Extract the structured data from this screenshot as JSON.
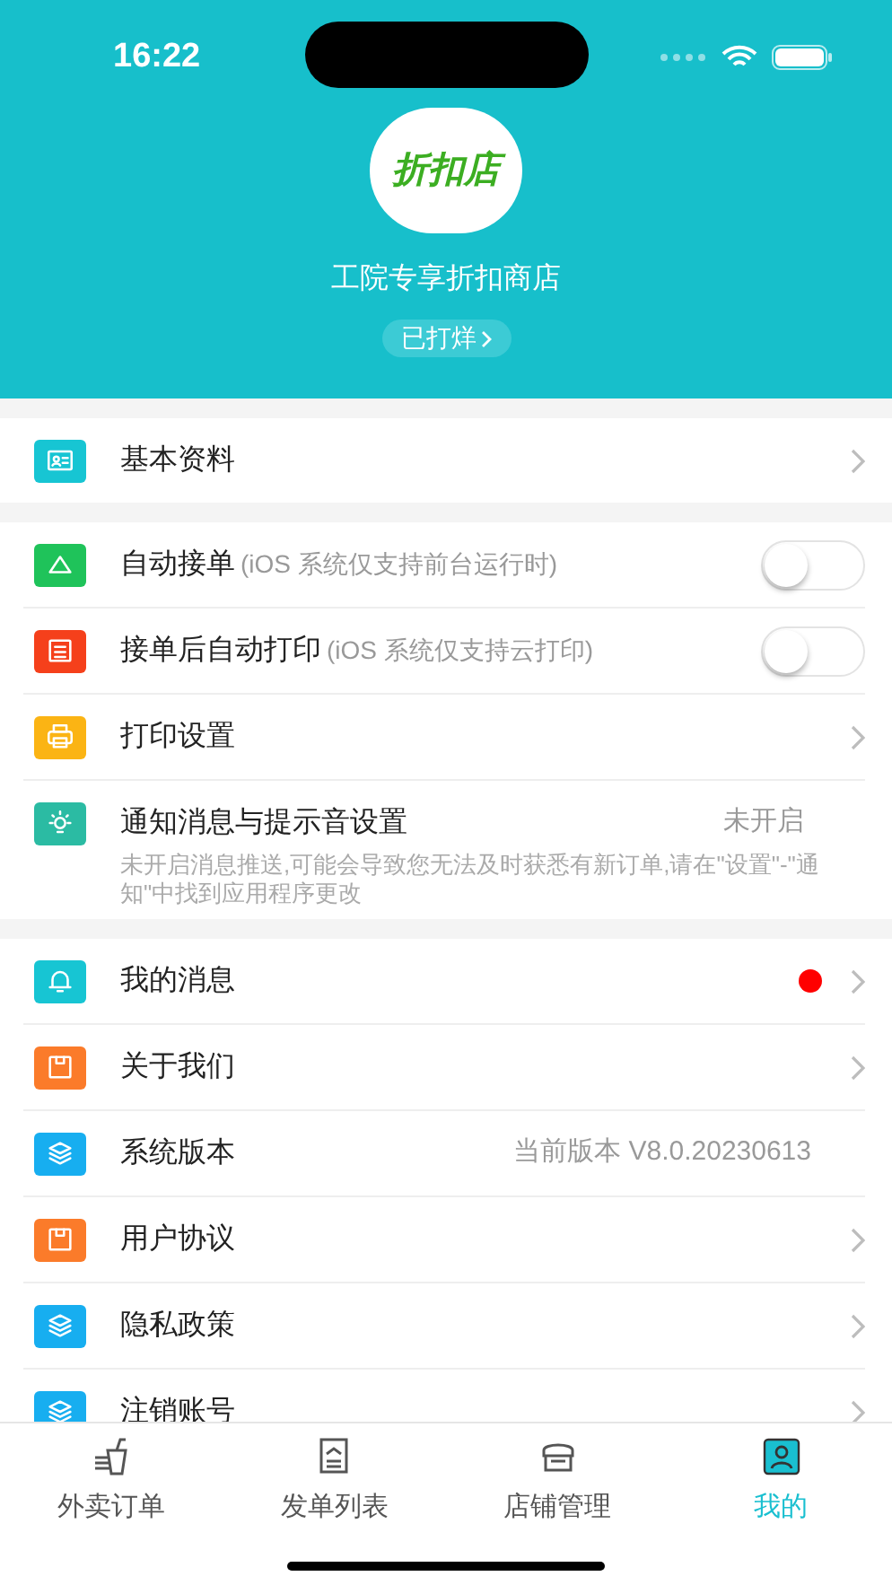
{
  "status_bar": {
    "time": "16:22"
  },
  "profile": {
    "logo_text": "折扣店",
    "shop_name": "工院专享折扣商店",
    "status_badge": "已打烊"
  },
  "sections": [
    {
      "items": [
        {
          "kind": "nav",
          "color": "#17c5d3",
          "label": "基本资料"
        }
      ]
    },
    {
      "items": [
        {
          "kind": "toggle",
          "color": "#1fc35a",
          "label": "自动接单",
          "note": "(iOS 系统仅支持前台运行时)",
          "on": false
        },
        {
          "kind": "toggle",
          "color": "#f5401b",
          "label": "接单后自动打印",
          "note": "(iOS 系统仅支持云打印)",
          "on": false
        },
        {
          "kind": "nav",
          "color": "#fbb414",
          "label": "打印设置"
        },
        {
          "kind": "notice",
          "color": "#2bbba3",
          "label": "通知消息与提示音设置",
          "value": "未开启",
          "description": "未开启消息推送,可能会导致您无法及时获悉有新订单,请在\"设置\"-\"通知\"中找到应用程序更改"
        }
      ]
    },
    {
      "items": [
        {
          "kind": "nav",
          "color": "#17c5d3",
          "label": "我的消息",
          "unread": true
        },
        {
          "kind": "nav",
          "color": "#fb7b2a",
          "label": "关于我们"
        },
        {
          "kind": "value",
          "color": "#17aef0",
          "label": "系统版本",
          "value": "当前版本 V8.0.20230613"
        },
        {
          "kind": "nav",
          "color": "#fb7b2a",
          "label": "用户协议"
        },
        {
          "kind": "nav",
          "color": "#17aef0",
          "label": "隐私政策"
        },
        {
          "kind": "nav",
          "color": "#17aef0",
          "label": "注销账号"
        }
      ]
    }
  ],
  "tab_bar": [
    {
      "label": "外卖订单",
      "selected": false
    },
    {
      "label": "发单列表",
      "selected": false
    },
    {
      "label": "店铺管理",
      "selected": false
    },
    {
      "label": "我的",
      "selected": true
    }
  ]
}
